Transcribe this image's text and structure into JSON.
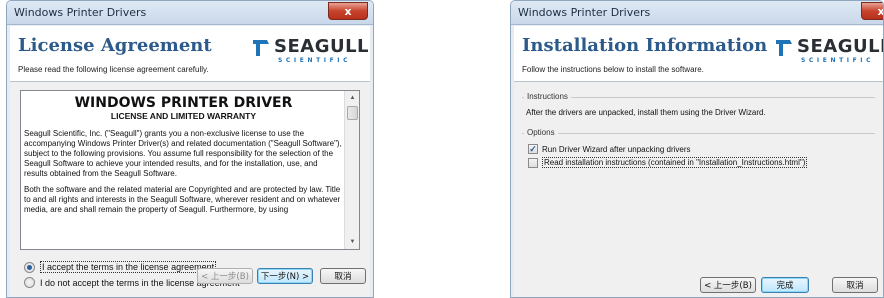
{
  "left_dialog": {
    "window_title": "Windows Printer Drivers",
    "close_glyph": "x",
    "heading": "License Agreement",
    "subheading": "Please read the following license agreement carefully.",
    "logo": {
      "brand": "SEAGULL",
      "tagline": "SCIENTIFIC"
    },
    "license": {
      "title": "WINDOWS PRINTER DRIVER",
      "subtitle": "LICENSE AND LIMITED WARRANTY",
      "paragraph1": "Seagull Scientific, Inc. (\"Seagull\") grants you a non-exclusive license to use the accompanying Windows Printer Driver(s) and related documentation (\"Seagull Software\"), subject to the following provisions. You assume full responsibility for the selection of the Seagull Software to achieve your intended results, and for the installation, use, and results obtained from the Seagull Software.",
      "paragraph2": "Both the software and the related material are Copyrighted and are protected by law. Title to and all rights and interests in the Seagull Software, wherever resident and on whatever media, are and shall remain the property of Seagull. Furthermore, by using"
    },
    "options": {
      "accept_label": "I accept the terms in the license agreement",
      "decline_label": "I do not accept the terms in the license agreement"
    },
    "buttons": {
      "back": "< 上一步(B)",
      "next": "下一步(N) >",
      "cancel": "取消"
    }
  },
  "right_dialog": {
    "window_title": "Windows Printer Drivers",
    "heading": "Installation Information",
    "subheading": "Follow the instructions below to install the software.",
    "logo": {
      "brand": "SEAGULL",
      "tagline": "SCIENTIFIC"
    },
    "instructions_label": "Instructions",
    "instructions_text": "After the drivers are unpacked, install them using the Driver Wizard.",
    "options_label": "Options",
    "option_run_wizard": "Run Driver Wizard after unpacking drivers",
    "option_read_instructions": "Read installation instructions (contained in \"Installation_Instructions.html\")",
    "option_run_wizard_checked": true,
    "option_read_instructions_checked": false,
    "buttons": {
      "back": "< 上一步(B)",
      "finish": "完成",
      "cancel": "取消"
    }
  },
  "colors": {
    "heading_blue": "#2c5a8b",
    "logo_blue": "#1f73b7",
    "close_red": "#c7432d"
  }
}
